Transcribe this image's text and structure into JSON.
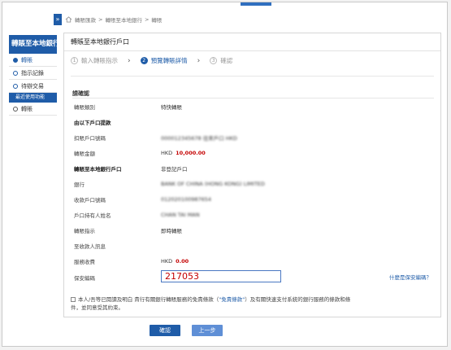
{
  "breadcrumb": [
    "轉賬匯款",
    ">",
    "轉賬至本地銀行",
    ">",
    "轉賬"
  ],
  "sidebar": {
    "title": "轉賬至本地銀行",
    "items": [
      {
        "label": "轉賬",
        "active": true
      },
      {
        "label": "指示記錄",
        "active": false
      },
      {
        "label": "待辦交易",
        "active": false
      }
    ],
    "sub_header": "最近使用功能",
    "recent": [
      {
        "label": "轉賬"
      }
    ]
  },
  "panel": {
    "title": "轉賬至本地銀行戶口",
    "steps": [
      {
        "num": "1",
        "label": "輸入轉賬指示"
      },
      {
        "num": "2",
        "label": "預覽轉賬詳情"
      },
      {
        "num": "3",
        "label": "確認"
      }
    ],
    "current_step": 2,
    "confirm_title": "請確認"
  },
  "details": {
    "transfer_type_label": "轉賬類別",
    "transfer_type_value": "特快轉賬",
    "from_heading": "由以下戶口提款",
    "debit_account_label": "扣賬戶口號碼",
    "debit_account_value": "000012345678 往來戶口 HKD",
    "amount_label": "轉賬金額",
    "amount_currency": "HKD",
    "amount_value": "10,000.00",
    "to_heading": "轉賬至本地銀行戶口",
    "to_heading_value": "非登記戶口",
    "bank_label": "銀行",
    "bank_value": "BANK OF CHINA (HONG KONG) LIMITED",
    "recv_account_label": "收款戶口號碼",
    "recv_account_value": "012020100987654",
    "holder_label": "戶口持有人姓名",
    "holder_value": "CHAN TAI MAN",
    "instruction_label": "轉賬指示",
    "instruction_value": "即時轉賬",
    "message_label": "至收款人訊息",
    "fee_label": "服務收費",
    "fee_currency": "HKD",
    "fee_value": "0.00",
    "security_label": "保安編碼",
    "security_value": "217053",
    "security_link": "什麼是保安編碼？"
  },
  "terms": {
    "text_a": "本人/吾等已閱讀及明白 貴行有關銀行轉賬服務的免責條款（",
    "link_a": "\"免責條款\"",
    "text_b": "）及有關快速支付系統的銀行服務的條款和條",
    "text_c": "件，並同意受其約束。"
  },
  "buttons": {
    "confirm": "確認",
    "back": "上一步"
  },
  "colors": {
    "brand": "#1f5ca8",
    "amount": "#c40000"
  }
}
